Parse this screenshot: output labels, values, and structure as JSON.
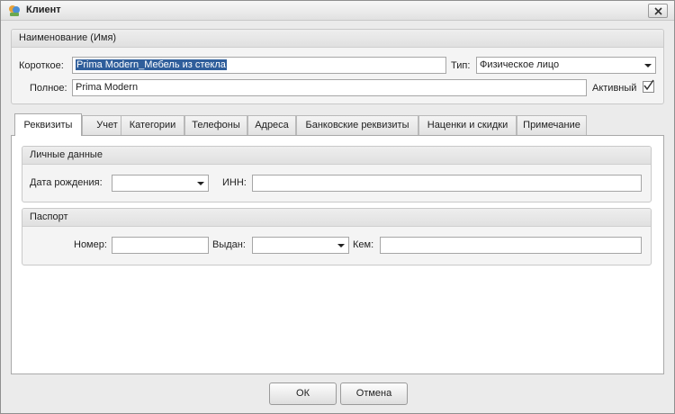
{
  "window": {
    "title": "Клиент"
  },
  "name_group": {
    "header": "Наименование (Имя)",
    "short_label": "Короткое:",
    "short_value": "Prima Modern_Мебель из стекла",
    "type_label": "Тип:",
    "type_value": "Физическое лицо",
    "full_label": "Полное:",
    "full_value": "Prima Modern",
    "active_label": "Активный",
    "active_checked": true
  },
  "tabs": [
    {
      "label": "Реквизиты",
      "active": true
    },
    {
      "label": "Учет"
    },
    {
      "label": "Категории"
    },
    {
      "label": "Телефоны"
    },
    {
      "label": "Адреса"
    },
    {
      "label": "Банковские реквизиты"
    },
    {
      "label": "Наценки и скидки"
    },
    {
      "label": "Примечание"
    }
  ],
  "personal": {
    "header": "Личные данные",
    "birth_label": "Дата рождения:",
    "birth_value": "",
    "inn_label": "ИНН:",
    "inn_value": ""
  },
  "passport": {
    "header": "Паспорт",
    "number_label": "Номер:",
    "number_value": "",
    "issued_label": "Выдан:",
    "issued_value": "",
    "by_label": "Кем:",
    "by_value": ""
  },
  "buttons": {
    "ok": "ОК",
    "cancel": "Отмена"
  }
}
